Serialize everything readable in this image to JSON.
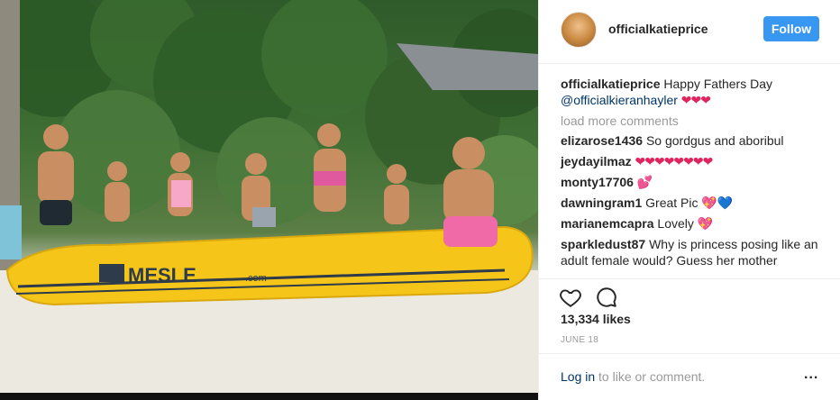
{
  "post": {
    "username": "officialkatieprice",
    "follow_label": "Follow",
    "caption": {
      "user": "officialkatieprice",
      "text": "Happy Fathers Day",
      "mention": "@officialkieranhayler",
      "hearts": "❤❤❤"
    },
    "load_more": "load more comments",
    "comments": [
      {
        "user": "elizarose1436",
        "text": "So gordgus and aboribul"
      },
      {
        "user": "jeydayilmaz",
        "text": "❤❤❤❤❤❤❤❤"
      },
      {
        "user": "monty17706",
        "text": "💕"
      },
      {
        "user": "dawningram1",
        "text": "Great Pic 💖💙"
      },
      {
        "user": "marianemcapra",
        "text": "Lovely 💖"
      },
      {
        "user": "sparkledust87",
        "text": "Why is princess posing like an adult female would? Guess her mother"
      }
    ],
    "likes": "13,334 likes",
    "date": "JUNE 18",
    "login_link": "Log in",
    "login_text": "to like or comment.",
    "more_label": "..."
  },
  "photo": {
    "banana_boat_brand": "MESLE",
    "banana_boat_domain": ".com"
  },
  "icons": {
    "like": "heart-icon",
    "comment": "comment-icon"
  },
  "colors": {
    "follow_button": "#3897f0",
    "mention": "#003569",
    "muted": "#999999"
  }
}
